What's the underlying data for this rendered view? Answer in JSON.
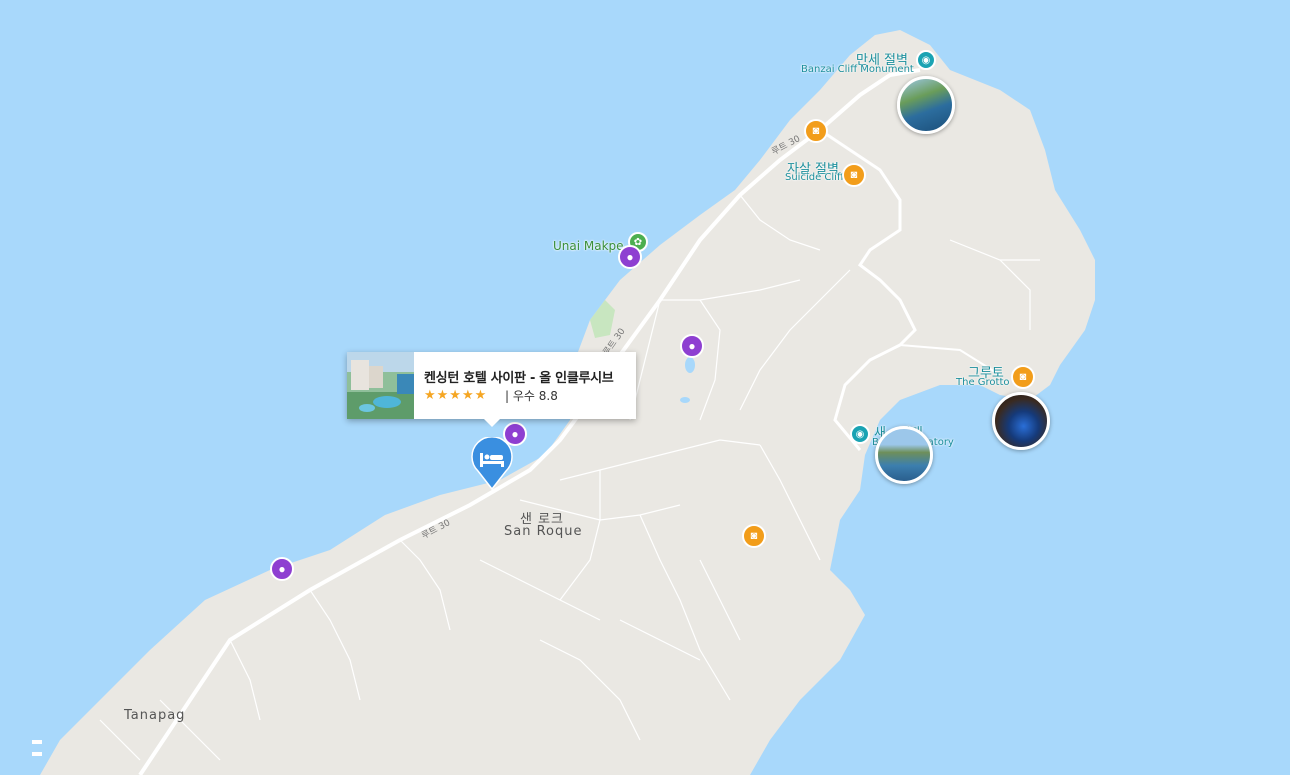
{
  "colors": {
    "water": "#a8d8fb",
    "land": "#eae8e3",
    "road": "#ffffff",
    "photo_pin": "#f29d1a",
    "event_pin": "#8e3fd1",
    "landmark_pin": "#1aa3b3",
    "park_pin": "#4caf50",
    "hotel_pin": "#3a8fe0"
  },
  "places": {
    "banzai": {
      "ko": "만세 절벽",
      "en": "Banzai Cliff Monument",
      "icon": "camera-icon"
    },
    "suicide": {
      "ko": "자살 절벽",
      "en": "Suicide Cliff",
      "icon": "camera-icon"
    },
    "unai": {
      "en": "Unai Makpe",
      "icon": "park-icon"
    },
    "grotto": {
      "ko": "그루토",
      "en": "The Grotto",
      "icon": "camera-icon"
    },
    "observatory": {
      "ko": "새…망대",
      "en": "B… Observatory",
      "icon": "camera-icon"
    }
  },
  "towns": {
    "san_roque_ko": "샌 로크",
    "san_roque_en": "San Roque",
    "tanapag": "Tanapag"
  },
  "routes": {
    "route30": "루트 30"
  },
  "hotel_card": {
    "title": "켄싱턴 호텔 사이판 - 올 인클루시브",
    "stars": "★★★★★",
    "rating": "| 우수 8.8",
    "icon": "bed-icon"
  }
}
